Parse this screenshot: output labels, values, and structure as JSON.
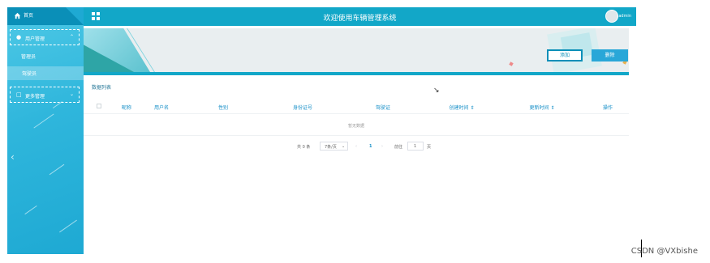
{
  "header": {
    "title": "欢迎使用车辆管理系统",
    "user": "admin"
  },
  "sidebar": {
    "home_label": "首页",
    "groups": [
      {
        "label": "用户管理",
        "children": [
          "管理员",
          "驾驶员"
        ]
      },
      {
        "label": "更多管理"
      }
    ]
  },
  "toolbar": {
    "add_label": "添加",
    "delete_label": "删除"
  },
  "table": {
    "caption": "数据列表",
    "columns": [
      "昵称",
      "用户名",
      "性别",
      "身份证号",
      "驾驶证",
      "创建时间 ⇕",
      "更新时间 ⇕",
      "操作"
    ],
    "empty_text": "暂无数据"
  },
  "pagination": {
    "total": "共 0 条",
    "page_size": "7条/页",
    "current_page": "1",
    "goto_prefix": "前往",
    "goto_value": "1",
    "goto_suffix": "页"
  },
  "watermark": "CSDN @VXbishe",
  "colors": {
    "primary": "#12a7c8",
    "sidebar": "#2fb6dc",
    "accent_text": "#1890c8"
  }
}
